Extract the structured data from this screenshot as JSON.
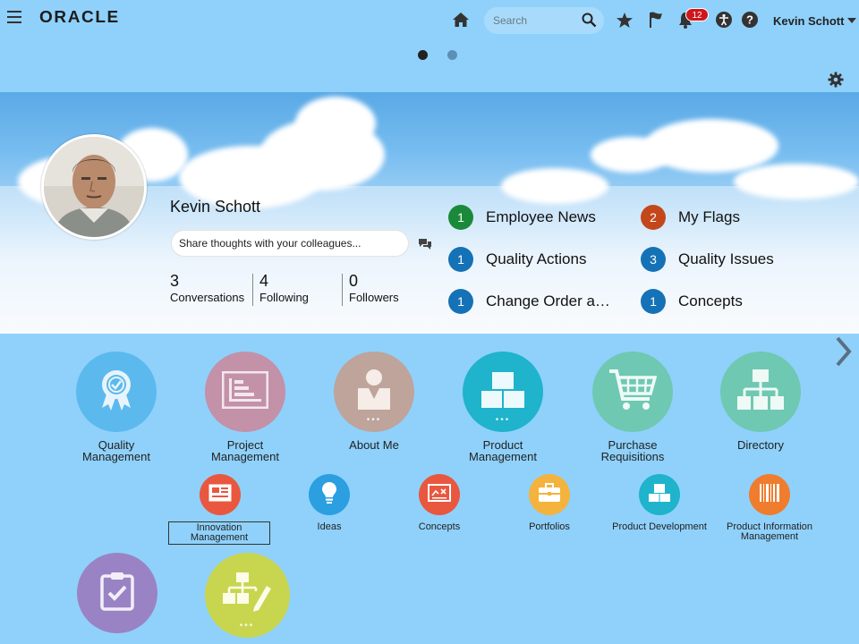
{
  "header": {
    "logo": "ORACLE",
    "search_placeholder": "Search",
    "notification_count": "12",
    "user_name": "Kevin Schott"
  },
  "carousel": {
    "page_count": 2,
    "active_index": 0
  },
  "profile": {
    "name": "Kevin Schott",
    "share_placeholder": "Share thoughts with your colleagues...",
    "stats": [
      {
        "value": "3",
        "label": "Conversations"
      },
      {
        "value": "4",
        "label": "Following"
      },
      {
        "value": "0",
        "label": "Followers"
      }
    ]
  },
  "notifications": [
    {
      "count": "1",
      "label": "Employee News",
      "color": "#1a8a3a"
    },
    {
      "count": "2",
      "label": "My Flags",
      "color": "#c4471c"
    },
    {
      "count": "1",
      "label": "Quality Actions",
      "color": "#1572b6"
    },
    {
      "count": "3",
      "label": "Quality Issues",
      "color": "#1572b6"
    },
    {
      "count": "1",
      "label": "Change Order a…",
      "color": "#1572b6"
    },
    {
      "count": "1",
      "label": "Concepts",
      "color": "#1572b6"
    }
  ],
  "apps": [
    {
      "line1": "Quality",
      "line2": "Management",
      "icon": "award-ribbon-icon",
      "color": "#5bb9ee"
    },
    {
      "line1": "Project",
      "line2": "Management",
      "icon": "gantt-chart-icon",
      "color": "#c391a8"
    },
    {
      "line1": "About Me",
      "line2": "",
      "icon": "person-badge-icon",
      "color": "#bea49a"
    },
    {
      "line1": "Product",
      "line2": "Management",
      "icon": "stacked-boxes-icon",
      "color": "#1fb3cc"
    },
    {
      "line1": "Purchase",
      "line2": "Requisitions",
      "icon": "shopping-cart-icon",
      "color": "#6fc8b2"
    },
    {
      "line1": "Directory",
      "line2": "",
      "icon": "org-chart-icon",
      "color": "#6fc8b2"
    }
  ],
  "subapps": [
    {
      "line1": "Innovation",
      "line2": "Management",
      "icon": "innovation-board-icon",
      "color": "#e9573f"
    },
    {
      "line1": "Ideas",
      "line2": "",
      "icon": "lightbulb-icon",
      "color": "#2b9fe0"
    },
    {
      "line1": "Concepts",
      "line2": "",
      "icon": "concept-board-icon",
      "color": "#e9573f"
    },
    {
      "line1": "Portfolios",
      "line2": "",
      "icon": "briefcase-icon",
      "color": "#f3b33d"
    },
    {
      "line1": "Product Development",
      "line2": "",
      "icon": "stacked-boxes-icon",
      "color": "#1fb3cc"
    },
    {
      "line1": "Product Information",
      "line2": "Management",
      "icon": "barcode-icon",
      "color": "#f07c2e"
    }
  ],
  "bottom_apps": [
    {
      "icon": "clipboard-check-icon",
      "color": "#9a83c4"
    },
    {
      "icon": "workflow-edit-icon",
      "color": "#c8d64f"
    }
  ]
}
